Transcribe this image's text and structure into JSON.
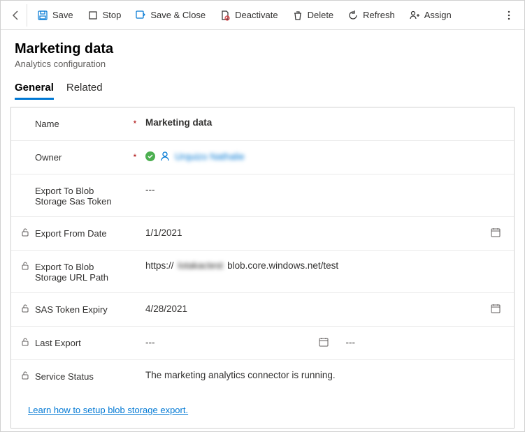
{
  "toolbar": {
    "save": "Save",
    "stop": "Stop",
    "saveClose": "Save & Close",
    "deactivate": "Deactivate",
    "delete": "Delete",
    "refresh": "Refresh",
    "assign": "Assign"
  },
  "header": {
    "title": "Marketing data",
    "subtitle": "Analytics configuration"
  },
  "tabs": {
    "general": "General",
    "related": "Related"
  },
  "form": {
    "name": {
      "label": "Name",
      "value": "Marketing data"
    },
    "owner": {
      "label": "Owner",
      "value": "Urquizo Nathalie"
    },
    "sasToken": {
      "label": "Export To Blob Storage Sas Token",
      "value": "---"
    },
    "fromDate": {
      "label": "Export From Date",
      "value": "1/1/2021"
    },
    "urlPath": {
      "label": "Export To Blob Storage URL Path",
      "prefix": "https://",
      "blurred": "lotakactest",
      "suffix": "blob.core.windows.net/test"
    },
    "sasExpiry": {
      "label": "SAS Token Expiry",
      "value": "4/28/2021"
    },
    "lastExport": {
      "label": "Last Export",
      "value1": "---",
      "value2": "---"
    },
    "serviceStatus": {
      "label": "Service Status",
      "value": "The marketing analytics connector is running."
    }
  },
  "helpLink": "Learn how to setup blob storage export."
}
